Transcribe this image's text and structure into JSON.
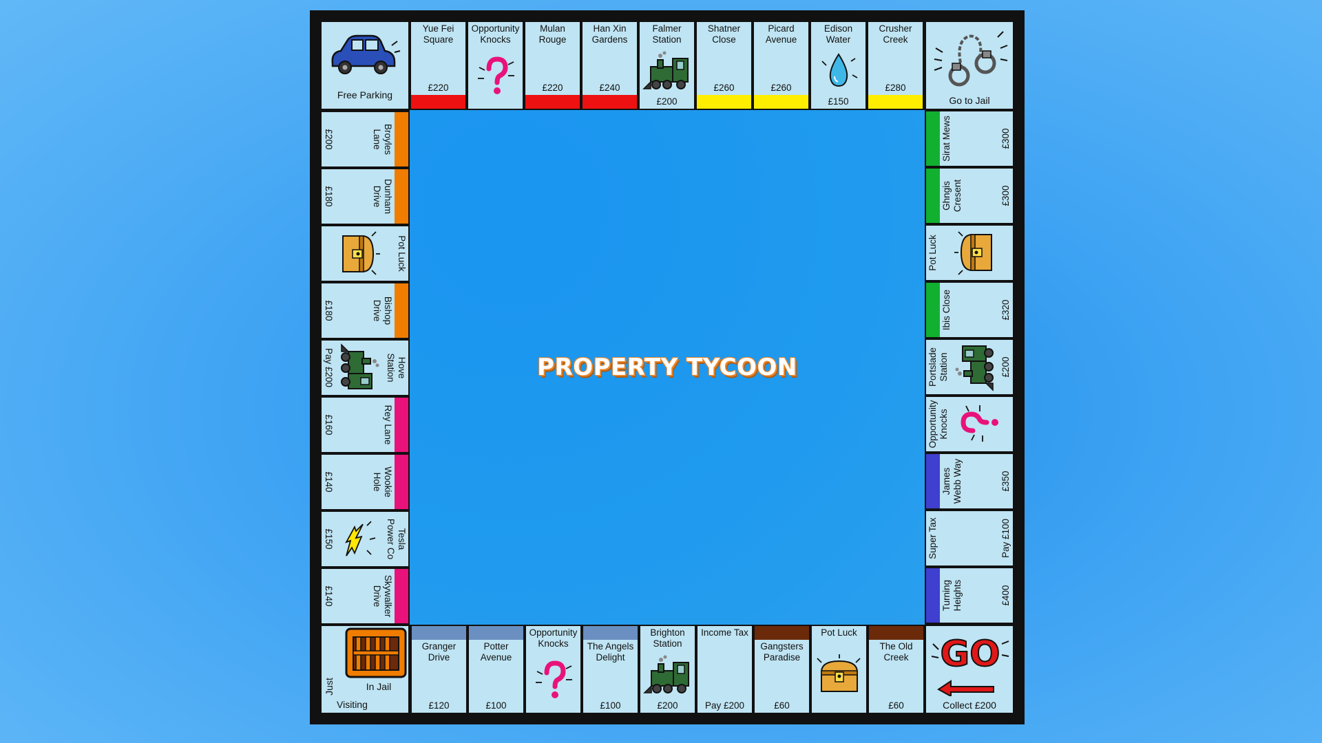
{
  "title": "PROPERTY TYCOON",
  "colors": {
    "red": "#ee1111",
    "yellow": "#ffee00",
    "orange": "#f07c00",
    "pink": "#e8127a",
    "green": "#12b030",
    "blue": "#3f3fd0",
    "lightblue": "#6a8fc0",
    "brown": "#6b2a0a",
    "tile": "#bfe4f3"
  },
  "corners": {
    "free_parking": {
      "label": "Free Parking",
      "icon": "car-icon"
    },
    "go_to_jail": {
      "label": "Go to Jail",
      "icon": "handcuffs-icon"
    },
    "go": {
      "label": "Collect £200",
      "icon": "go-icon",
      "big": "GO"
    },
    "jail": {
      "label": "In Jail",
      "label2a": "Just",
      "label2b": "Visiting",
      "icon": "jail-bars-icon"
    }
  },
  "top": [
    {
      "name": "Yue Fei Square",
      "price": "£220",
      "group": "red"
    },
    {
      "name": "Opportunity Knocks",
      "icon": "question-icon"
    },
    {
      "name": "Mulan Rouge",
      "price": "£220",
      "group": "red"
    },
    {
      "name": "Han Xin Gardens",
      "price": "£240",
      "group": "red"
    },
    {
      "name": "Falmer Station",
      "price": "£200",
      "icon": "train-icon"
    },
    {
      "name": "Shatner Close",
      "price": "£260",
      "group": "yellow"
    },
    {
      "name": "Picard Avenue",
      "price": "£260",
      "group": "yellow"
    },
    {
      "name": "Edison Water",
      "price": "£150",
      "icon": "water-drop-icon"
    },
    {
      "name": "Crusher Creek",
      "price": "£280",
      "group": "yellow"
    }
  ],
  "right": [
    {
      "name": "Sirat Mews",
      "price": "£300",
      "group": "green"
    },
    {
      "name": "Ghngis Cresent",
      "price": "£300",
      "group": "green"
    },
    {
      "name": "Pot Luck",
      "icon": "chest-icon"
    },
    {
      "name": "Ibis Close",
      "price": "£320",
      "group": "green"
    },
    {
      "name": "Portslade Station",
      "price": "£200",
      "icon": "train-icon"
    },
    {
      "name": "Opportunity Knocks",
      "icon": "question-icon"
    },
    {
      "name": "James Webb Way",
      "price": "£350",
      "group": "blue"
    },
    {
      "name": "Super Tax",
      "price": "Pay £100"
    },
    {
      "name": "Turning Heights",
      "price": "£400",
      "group": "blue"
    }
  ],
  "bottom": [
    {
      "name": "The Old Creek",
      "price": "£60",
      "group": "brown"
    },
    {
      "name": "Pot Luck",
      "icon": "chest-icon"
    },
    {
      "name": "Gangsters Paradise",
      "price": "£60",
      "group": "brown"
    },
    {
      "name": "Income Tax",
      "price": "Pay £200"
    },
    {
      "name": "Brighton Station",
      "price": "£200",
      "icon": "train-icon"
    },
    {
      "name": "The Angels Delight",
      "price": "£100",
      "group": "lightblue"
    },
    {
      "name": "Opportunity Knocks",
      "icon": "question-icon"
    },
    {
      "name": "Potter Avenue",
      "price": "£100",
      "group": "lightblue"
    },
    {
      "name": "Granger Drive",
      "price": "£120",
      "group": "lightblue"
    }
  ],
  "left": [
    {
      "name": "Skywalker Drive",
      "price": "£140",
      "group": "pink"
    },
    {
      "name": "Tesla Power Co",
      "price": "£150",
      "icon": "lightning-icon"
    },
    {
      "name": "Wookie Hole",
      "price": "£140",
      "group": "pink"
    },
    {
      "name": "Rey Lane",
      "price": "£160",
      "group": "pink"
    },
    {
      "name": "Hove Station",
      "price": "Pay £200",
      "icon": "train-icon"
    },
    {
      "name": "Bishop Drive",
      "price": "£180",
      "group": "orange"
    },
    {
      "name": "Pot Luck",
      "icon": "chest-icon"
    },
    {
      "name": "Dunham Drive",
      "price": "£180",
      "group": "orange"
    },
    {
      "name": "Broyles Lane",
      "price": "£200",
      "group": "orange"
    }
  ]
}
